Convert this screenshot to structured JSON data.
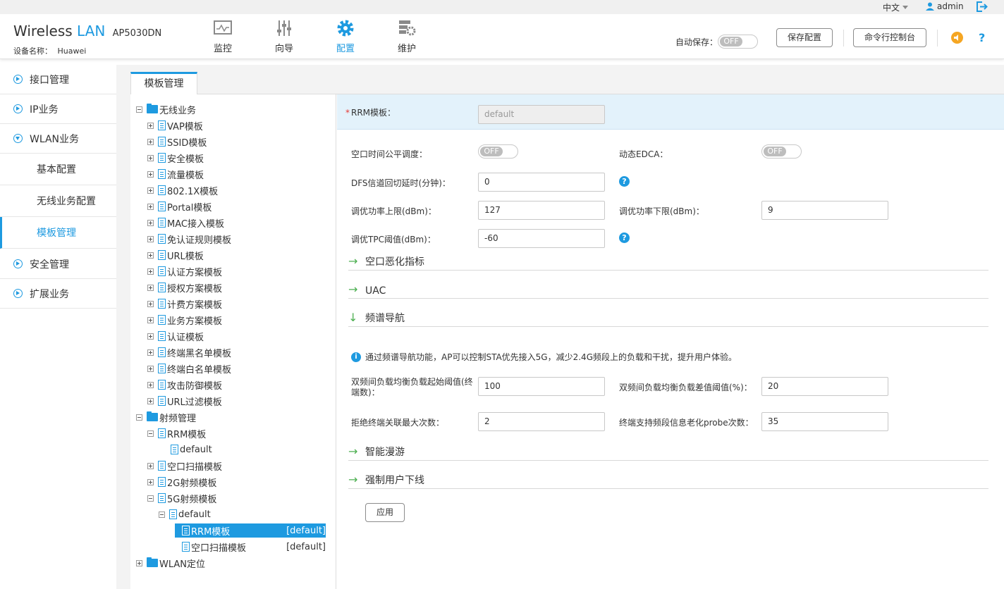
{
  "topbar": {
    "language": "中文",
    "user": "admin"
  },
  "header": {
    "brand_1": "Wireless",
    "brand_2": "LAN",
    "model": "AP5030DN",
    "device_label": "设备名称：",
    "device_name": "Huawei",
    "nav": [
      {
        "label": "监控",
        "icon": "monitor-icon",
        "active": false
      },
      {
        "label": "向导",
        "icon": "sliders-icon",
        "active": false
      },
      {
        "label": "配置",
        "icon": "gear-icon",
        "active": true
      },
      {
        "label": "维护",
        "icon": "maintenance-icon",
        "active": false
      }
    ],
    "autosave_label": "自动保存：",
    "autosave_state": "OFF",
    "save_button": "保存配置",
    "cli_button": "命令行控制台"
  },
  "sidebar": {
    "items": [
      {
        "label": "接口管理"
      },
      {
        "label": "IP业务"
      },
      {
        "label": "WLAN业务"
      },
      {
        "label": "安全管理"
      },
      {
        "label": "扩展业务"
      }
    ],
    "subitems": [
      {
        "label": "基本配置"
      },
      {
        "label": "无线业务配置"
      },
      {
        "label": "模板管理"
      }
    ]
  },
  "tab": {
    "label": "模板管理"
  },
  "tree": {
    "wireless": "无线业务",
    "wireless_children": [
      "VAP模板",
      "SSID模板",
      "安全模板",
      "流量模板",
      "802.1X模板",
      "Portal模板",
      "MAC接入模板",
      "免认证规则模板",
      "URL模板",
      "认证方案模板",
      "授权方案模板",
      "计费方案模板",
      "业务方案模板",
      "认证模板",
      "终端黑名单模板",
      "终端白名单模板",
      "攻击防御模板",
      "URL过滤模板"
    ],
    "radio": "射频管理",
    "rrm": "RRM模板",
    "rrm_default": "default",
    "scan": "空口扫描模板",
    "radio2g": "2G射频模板",
    "radio5g": "5G射频模板",
    "radio5g_default": "default",
    "rrm_sel": "RRM模板",
    "rrm_sel_tag": "[default]",
    "scan_sub": "空口扫描模板",
    "scan_sub_tag": "[default]",
    "wlan_loc": "WLAN定位"
  },
  "form": {
    "rrm_label": "RRM模板：",
    "rrm_value": "default",
    "airtime_label": "空口时间公平调度：",
    "airtime_state": "OFF",
    "edca_label": "动态EDCA：",
    "edca_state": "OFF",
    "dfs_label": "DFS信道回切延时(分钟)：",
    "dfs_value": "0",
    "pmax_label": "调优功率上限(dBm)：",
    "pmax_value": "127",
    "pmin_label": "调优功率下限(dBm)：",
    "pmin_value": "9",
    "tpc_label": "调优TPC阈值(dBm)：",
    "tpc_value": "-60",
    "sec_degrade": "空口恶化指标",
    "sec_uac": "UAC",
    "sec_band": "频谱导航",
    "band_info": "通过频谱导航功能，AP可以控制STA优先接入5G，减少2.4G频段上的负载和干扰，提升用户体验。",
    "lb_start_label_1": "双频间负载均衡负载起始阈值(终",
    "lb_start_label_2": "端数)：",
    "lb_start_value": "100",
    "lb_gap_label": "双频间负载均衡负载差值阈值(%)：",
    "lb_gap_value": "20",
    "reject_label": "拒绝终端关联最大次数：",
    "reject_value": "2",
    "probe_label": "终端支持频段信息老化probe次数：",
    "probe_value": "35",
    "sec_roam": "智能漫游",
    "sec_kick": "强制用户下线",
    "apply_button": "应用"
  }
}
